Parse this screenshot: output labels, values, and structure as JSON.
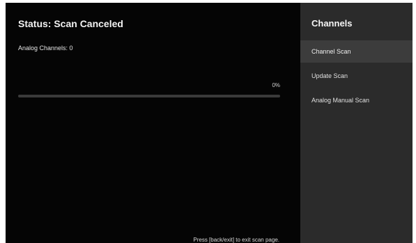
{
  "status": {
    "title": "Status: Scan Canceled",
    "analog_channels": "Analog Channels: 0"
  },
  "progress": {
    "percent_label": "0%",
    "value": 0
  },
  "hint": "Press [back/exit] to exit scan page.",
  "panel": {
    "title": "Channels",
    "items": [
      {
        "label": "Channel Scan",
        "selected": true
      },
      {
        "label": "Update Scan",
        "selected": false
      },
      {
        "label": "Analog Manual Scan",
        "selected": false
      }
    ]
  },
  "colors": {
    "background": "#050505",
    "panel": "#2b2b2b",
    "selected_item": "#3c3c3c"
  }
}
